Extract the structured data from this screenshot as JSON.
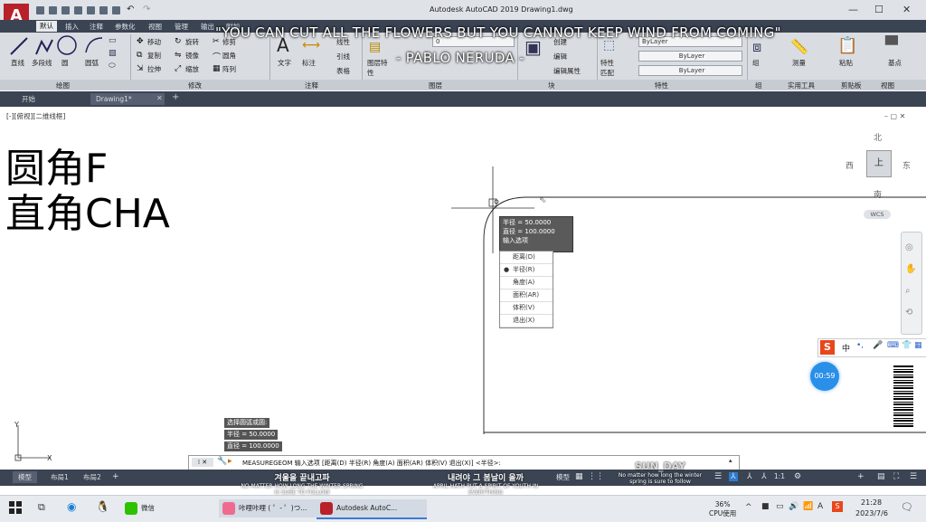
{
  "window": {
    "title": "Autodesk AutoCAD 2019    Drawing1.dwg",
    "logo": "A"
  },
  "menu_tabs": [
    "默认",
    "插入",
    "注释",
    "参数化",
    "视图",
    "管理",
    "输出",
    "附加"
  ],
  "ribbon": {
    "draw": {
      "line": "直线",
      "polyline": "多段线",
      "circle": "圆",
      "arc": "圆弧"
    },
    "modify": {
      "move": "移动",
      "rotate": "旋转",
      "trim": "修剪",
      "copy": "复制",
      "mirror": "镜像",
      "fillet": "圆角",
      "stretch": "拉伸",
      "scale": "缩放",
      "array": "阵列"
    },
    "annotation": {
      "text": "文字",
      "dimension": "标注",
      "linear": "线性",
      "leader": "引线",
      "table": "表格"
    },
    "layers": {
      "layer_props": "图层特性",
      "current_layer": "0"
    },
    "block": {
      "insert": "插入",
      "create": "创建",
      "edit": "编辑",
      "edit_attr": "编辑属性"
    },
    "properties": {
      "match": "特性匹配",
      "color": "ByLayer",
      "linetype": "ByLayer",
      "lineweight": "ByLayer"
    },
    "groups": {
      "group": "组"
    },
    "utilities": {
      "measure": "测量"
    },
    "clipboard": {
      "paste": "粘贴"
    },
    "view": {
      "base": "基点"
    },
    "panel_titles": [
      "绘图",
      "修改",
      "注释",
      "图层",
      "块",
      "特性",
      "组",
      "实用工具",
      "剪贴板",
      "视图"
    ]
  },
  "overlay_quote": {
    "line1": "\"YOU CAN CUT ALL THE FLOWERS BUT YOU CANNOT KEEP WIND FROM COMING\"",
    "line2": "- PABLO NERUDA -"
  },
  "doc_tabs": [
    "开始",
    "Drawing1*"
  ],
  "viewport_label": "[-][俯视][二维线框]",
  "notes": {
    "line1": "圆角F",
    "line2": "直角CHA"
  },
  "tooltip": {
    "line1": "半径 = 50.0000",
    "line2": "直径 = 100.0000",
    "line3": "输入选项"
  },
  "options": [
    "距离(D)",
    "半径(R)",
    "角度(A)",
    "面积(AR)",
    "体积(V)",
    "退出(X)"
  ],
  "selected_option": "半径(R)",
  "viewcube": {
    "north": "北",
    "west": "西",
    "east": "东",
    "south": "南",
    "face": "上",
    "wcs": "WCS"
  },
  "command_history": [
    "选择圆弧或圆:",
    "半径 = 50.0000",
    "直径 = 100.0000"
  ],
  "command_line": "MEASUREGEOM 输入选项 [距离(D) 半径(R) 角度(A) 面积(AR) 体积(V) 退出(X)] <半径>:",
  "layout_tabs": [
    "模型",
    "布局1",
    "布局2"
  ],
  "status": {
    "mode": "模型",
    "annotation_scale": "1:1"
  },
  "korean_captions": [
    {
      "title": "겨울을 끝내고파",
      "sub": "NO MATTER HOW LONG THE WINTER SPRING IS SURE TO FOLLOW"
    },
    {
      "title": "내려야 그 봄날이 올까",
      "sub": "APRIL HATH PUT A SPIRIT OF YOUTH IN EVERYTHING"
    },
    {
      "title": "SUN_DAY",
      "sub": "No matter how long the winter spring is sure to follow"
    }
  ],
  "timer": "00:59",
  "ime": "中",
  "taskbar": {
    "apps": [
      "微信",
      "咔哩咔哩 ( ゜- ゜)つ...",
      "Autodesk AutoC..."
    ],
    "cpu_value": "36%",
    "cpu_label": "CPU使用",
    "time": "21:28",
    "date": "2023/7/6"
  },
  "colors": {
    "dark_bar": "#3b4453",
    "ribbon": "#d9dde2",
    "accent_red": "#b8202a",
    "timer_blue": "#2a8fe8"
  }
}
